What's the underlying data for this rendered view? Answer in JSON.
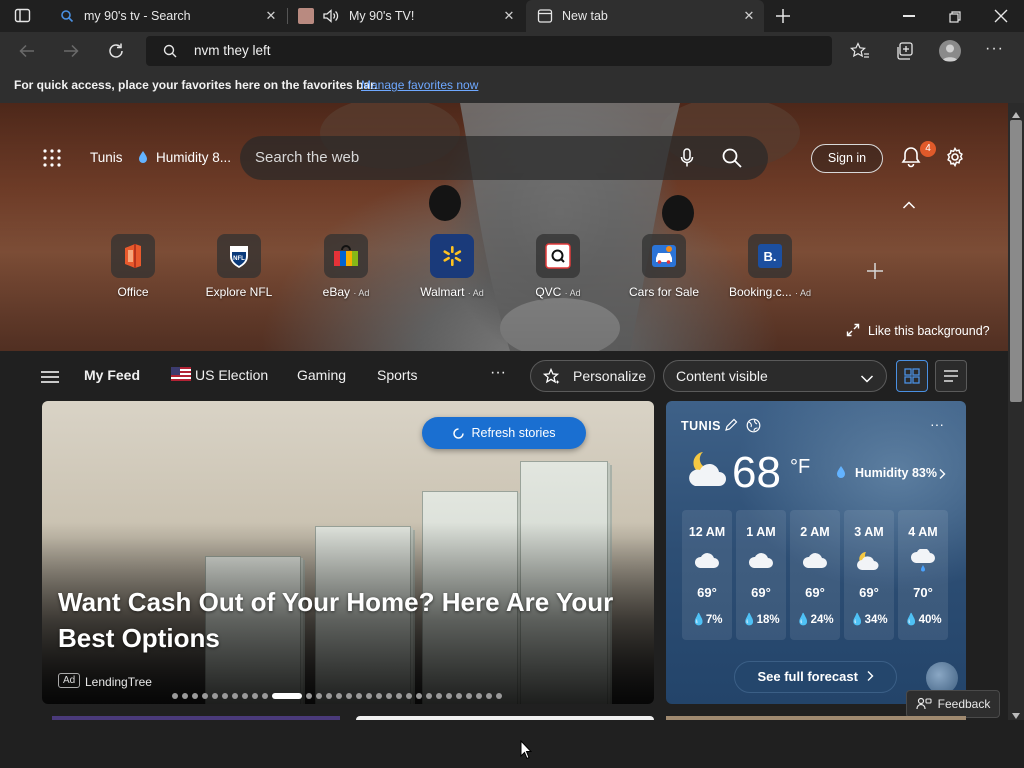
{
  "tabs": [
    {
      "title": "my 90's tv - Search",
      "active": false
    },
    {
      "title": "My 90's TV!",
      "active": false
    },
    {
      "title": "New tab",
      "active": true
    }
  ],
  "toolbar": {
    "address_value": "nvm they left"
  },
  "favorites_bar": {
    "message": "For quick access, place your favorites here on the favorites bar.",
    "link": "Manage favorites now"
  },
  "header": {
    "location": "Tunis",
    "humidity": "Humidity 8...",
    "search_placeholder": "Search the web",
    "signin": "Sign in",
    "notif_count": "4"
  },
  "quick_links": [
    {
      "label": "Office",
      "ad": ""
    },
    {
      "label": "Explore NFL",
      "ad": ""
    },
    {
      "label": "eBay",
      "ad": "· Ad"
    },
    {
      "label": "Walmart",
      "ad": "· Ad"
    },
    {
      "label": "QVC",
      "ad": "· Ad"
    },
    {
      "label": "Cars for Sale",
      "ad": ""
    },
    {
      "label": "Booking.c...",
      "ad": "· Ad"
    }
  ],
  "like_background": "Like this background?",
  "feed_nav": {
    "my_feed": "My Feed",
    "items": [
      "US Election",
      "Gaming",
      "Sports"
    ],
    "more": "···",
    "personalize": "Personalize",
    "content": "Content visible"
  },
  "story": {
    "refresh": "Refresh stories",
    "headline": "Want Cash Out of Your Home? Here Are Your Best Options",
    "ad_label": "Ad",
    "source": "LendingTree"
  },
  "weather": {
    "city": "TUNIS",
    "temp": "68",
    "unit": "°F",
    "humidity": "Humidity 83%",
    "hours": [
      {
        "time": "12 AM",
        "temp": "69°",
        "precip": "7%",
        "icon": "cloud"
      },
      {
        "time": "1 AM",
        "temp": "69°",
        "precip": "18%",
        "icon": "cloud"
      },
      {
        "time": "2 AM",
        "temp": "69°",
        "precip": "24%",
        "icon": "cloud"
      },
      {
        "time": "3 AM",
        "temp": "69°",
        "precip": "34%",
        "icon": "partly-cloudy-night"
      },
      {
        "time": "4 AM",
        "temp": "70°",
        "precip": "40%",
        "icon": "rain-cloud"
      }
    ],
    "forecast_button": "See full forecast"
  },
  "feedback": "Feedback",
  "colors": {
    "accent": "#1a6fd1",
    "badge": "#e05a2a",
    "link": "#6ea8ff",
    "weather_bg": "#2d4e74"
  }
}
